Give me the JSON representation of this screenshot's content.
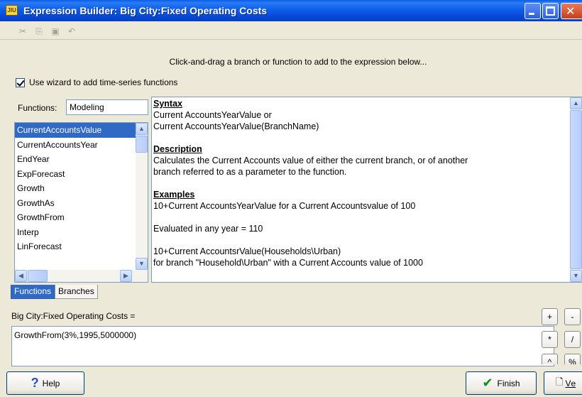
{
  "window": {
    "title": "Expression Builder: Big City:Fixed Operating Costs"
  },
  "hint": "Click-and-drag a branch or function to add to the expression below...",
  "wizard": {
    "label": "Use wizard to add time-series functions",
    "checked": true
  },
  "functions": {
    "label": "Functions:",
    "value": "Modeling",
    "items": [
      "CurrentAccountsValue",
      "CurrentAccountsYear",
      "EndYear",
      "ExpForecast",
      "Growth",
      "GrowthAs",
      "GrowthFrom",
      "Interp",
      "LinForecast"
    ],
    "selected": "CurrentAccountsValue"
  },
  "tabs": [
    "Functions",
    "Branches"
  ],
  "syntax_panel": {
    "syntax_heading": "Syntax",
    "syntax_line1": "Current AccountsYearValue or",
    "syntax_line2": "Current AccountsYearValue(BranchName)",
    "description_heading": "Description",
    "description_line1": "Calculates the Current Accounts value of either the current branch, or of another",
    "description_line2": "branch referred to as a parameter to the function.",
    "examples_heading": "Examples",
    "example1": "10+Current AccountsYearValue for a Current Accountsvalue of 100",
    "example1_result": "Evaluated in any year = 110",
    "example2": "10+Current AccountsrValue(Households\\Urban)",
    "example2_note": "for branch \"Household\\Urban\" with a Current Accounts value of 1000"
  },
  "expression": {
    "label": "Big City:Fixed Operating Costs =",
    "value": "GrowthFrom(3%,1995,5000000)"
  },
  "operators": [
    "+",
    "-",
    "*",
    "/",
    "^",
    "%"
  ],
  "buttons": {
    "help": "Help",
    "finish": "Finish",
    "view_prefix": "V",
    "view_rest": "e"
  },
  "icons": {
    "toolbar": [
      "cut-icon",
      "copy-icon",
      "paste-icon",
      "undo-icon"
    ]
  }
}
